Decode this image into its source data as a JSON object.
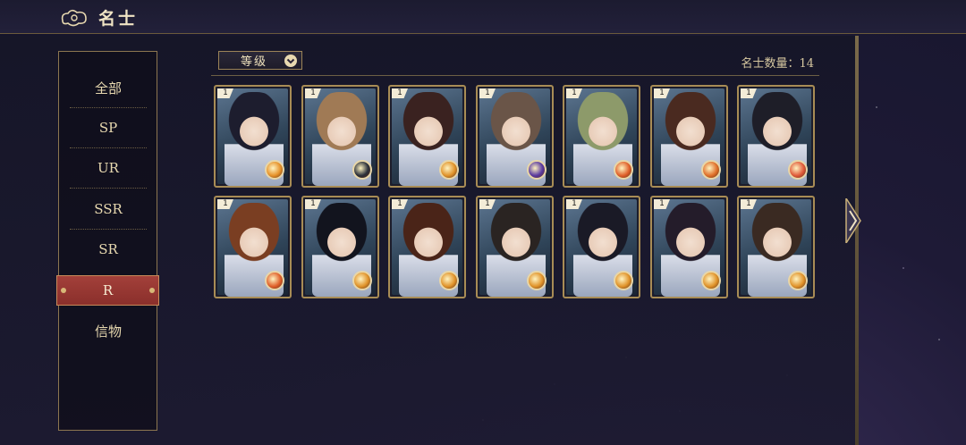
{
  "header": {
    "title": "名士",
    "icon": "cloud-swirl-icon"
  },
  "sidebar": {
    "items": [
      {
        "label": "全部",
        "active": false
      },
      {
        "label": "SP",
        "active": false
      },
      {
        "label": "UR",
        "active": false
      },
      {
        "label": "SSR",
        "active": false
      },
      {
        "label": "SR",
        "active": false
      },
      {
        "label": "R",
        "active": true
      },
      {
        "label": "信物",
        "active": false
      }
    ]
  },
  "toolbar": {
    "sort_label": "等级",
    "count_text": "名士数量：14"
  },
  "cards": [
    {
      "level": "1",
      "hair": "#1d1d2e",
      "badge": "#e6922a"
    },
    {
      "level": "1",
      "hair": "#a07a55",
      "badge": "#2a2f3a"
    },
    {
      "level": "1",
      "hair": "#3a2220",
      "badge": "#e0932a"
    },
    {
      "level": "1",
      "hair": "#6a5548",
      "badge": "#5a3aa0"
    },
    {
      "level": "1",
      "hair": "#8d9a6a",
      "badge": "#e0602a"
    },
    {
      "level": "1",
      "hair": "#4a2a20",
      "badge": "#e0702a"
    },
    {
      "level": "1",
      "hair": "#1e1e28",
      "badge": "#e05a3a"
    },
    {
      "level": "1",
      "hair": "#7a3e22",
      "badge": "#e0602a"
    },
    {
      "level": "1",
      "hair": "#12141e",
      "badge": "#e0932a"
    },
    {
      "level": "1",
      "hair": "#4a2418",
      "badge": "#e0932a"
    },
    {
      "level": "1",
      "hair": "#2a2422",
      "badge": "#e0932a"
    },
    {
      "level": "1",
      "hair": "#1a1a26",
      "badge": "#e0932a"
    },
    {
      "level": "1",
      "hair": "#241c2a",
      "badge": "#e0932a"
    },
    {
      "level": "1",
      "hair": "#3a2a22",
      "badge": "#e0932a"
    }
  ],
  "colors": {
    "accent_gold": "#a88c55",
    "active_red": "#8a2f2b",
    "text_cream": "#e8d9b0"
  }
}
